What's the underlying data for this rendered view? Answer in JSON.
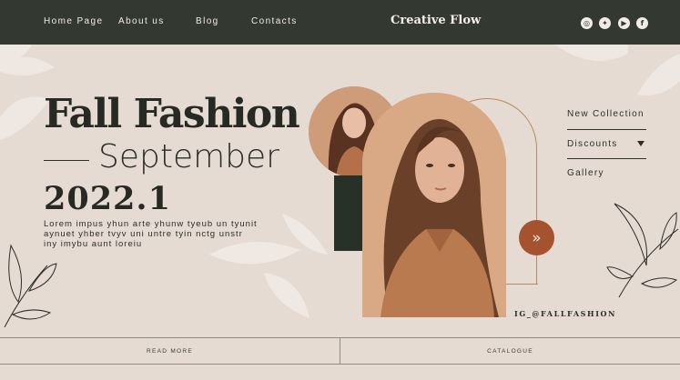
{
  "nav": {
    "home": "Home Page",
    "about": "About us",
    "blog": "Blog",
    "contacts": "Contacts"
  },
  "brand": "Creative Flow",
  "social": [
    {
      "icon": "instagram-icon",
      "glyph": "◎"
    },
    {
      "icon": "twitter-icon",
      "glyph": "✦"
    },
    {
      "icon": "youtube-icon",
      "glyph": "▶"
    },
    {
      "icon": "facebook-icon",
      "glyph": "f"
    }
  ],
  "hero": {
    "title": "Fall Fashion",
    "month": "September",
    "year": "2022.1",
    "body": "Lorem impus yhun arte yhunw tyeub un tyunit aynuet yhber tvyv uni untre tyin nctg unstr iny imybu aunt loreiu"
  },
  "side_menu": {
    "new_collection": "New Collection",
    "discounts": "Discounts",
    "gallery": "Gallery"
  },
  "next_glyph": "»",
  "instagram_handle": "IG_@FALLFASHION",
  "footer": {
    "read_more": "READ MORE",
    "catalogue": "CATALOGUE"
  },
  "colors": {
    "background": "#e6dbd3",
    "topbar": "#333831",
    "accent": "#a4532e",
    "dark_green": "#273127",
    "photo_backdrop": "#d9a985"
  }
}
